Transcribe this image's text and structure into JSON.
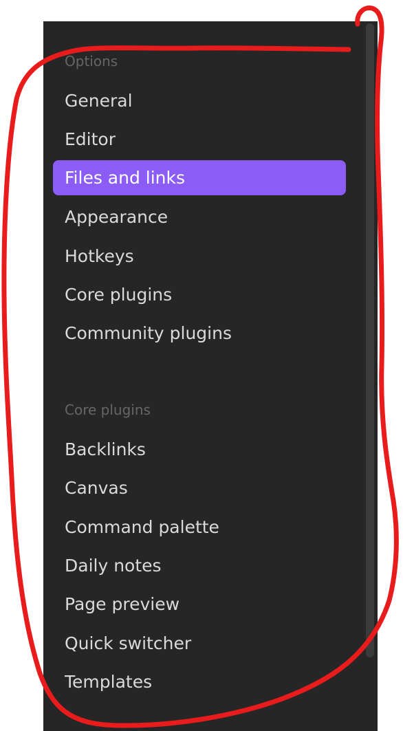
{
  "sections": [
    {
      "title": "Options",
      "items": [
        {
          "label": "General",
          "active": false
        },
        {
          "label": "Editor",
          "active": false
        },
        {
          "label": "Files and links",
          "active": true
        },
        {
          "label": "Appearance",
          "active": false
        },
        {
          "label": "Hotkeys",
          "active": false
        },
        {
          "label": "Core plugins",
          "active": false
        },
        {
          "label": "Community plugins",
          "active": false
        }
      ]
    },
    {
      "title": "Core plugins",
      "items": [
        {
          "label": "Backlinks",
          "active": false
        },
        {
          "label": "Canvas",
          "active": false
        },
        {
          "label": "Command palette",
          "active": false
        },
        {
          "label": "Daily notes",
          "active": false
        },
        {
          "label": "Page preview",
          "active": false
        },
        {
          "label": "Quick switcher",
          "active": false
        },
        {
          "label": "Templates",
          "active": false
        }
      ]
    }
  ],
  "colors": {
    "panel_background": "#262626",
    "active_item_background": "#8b5cf6",
    "annotation_stroke": "#e81c1c"
  }
}
